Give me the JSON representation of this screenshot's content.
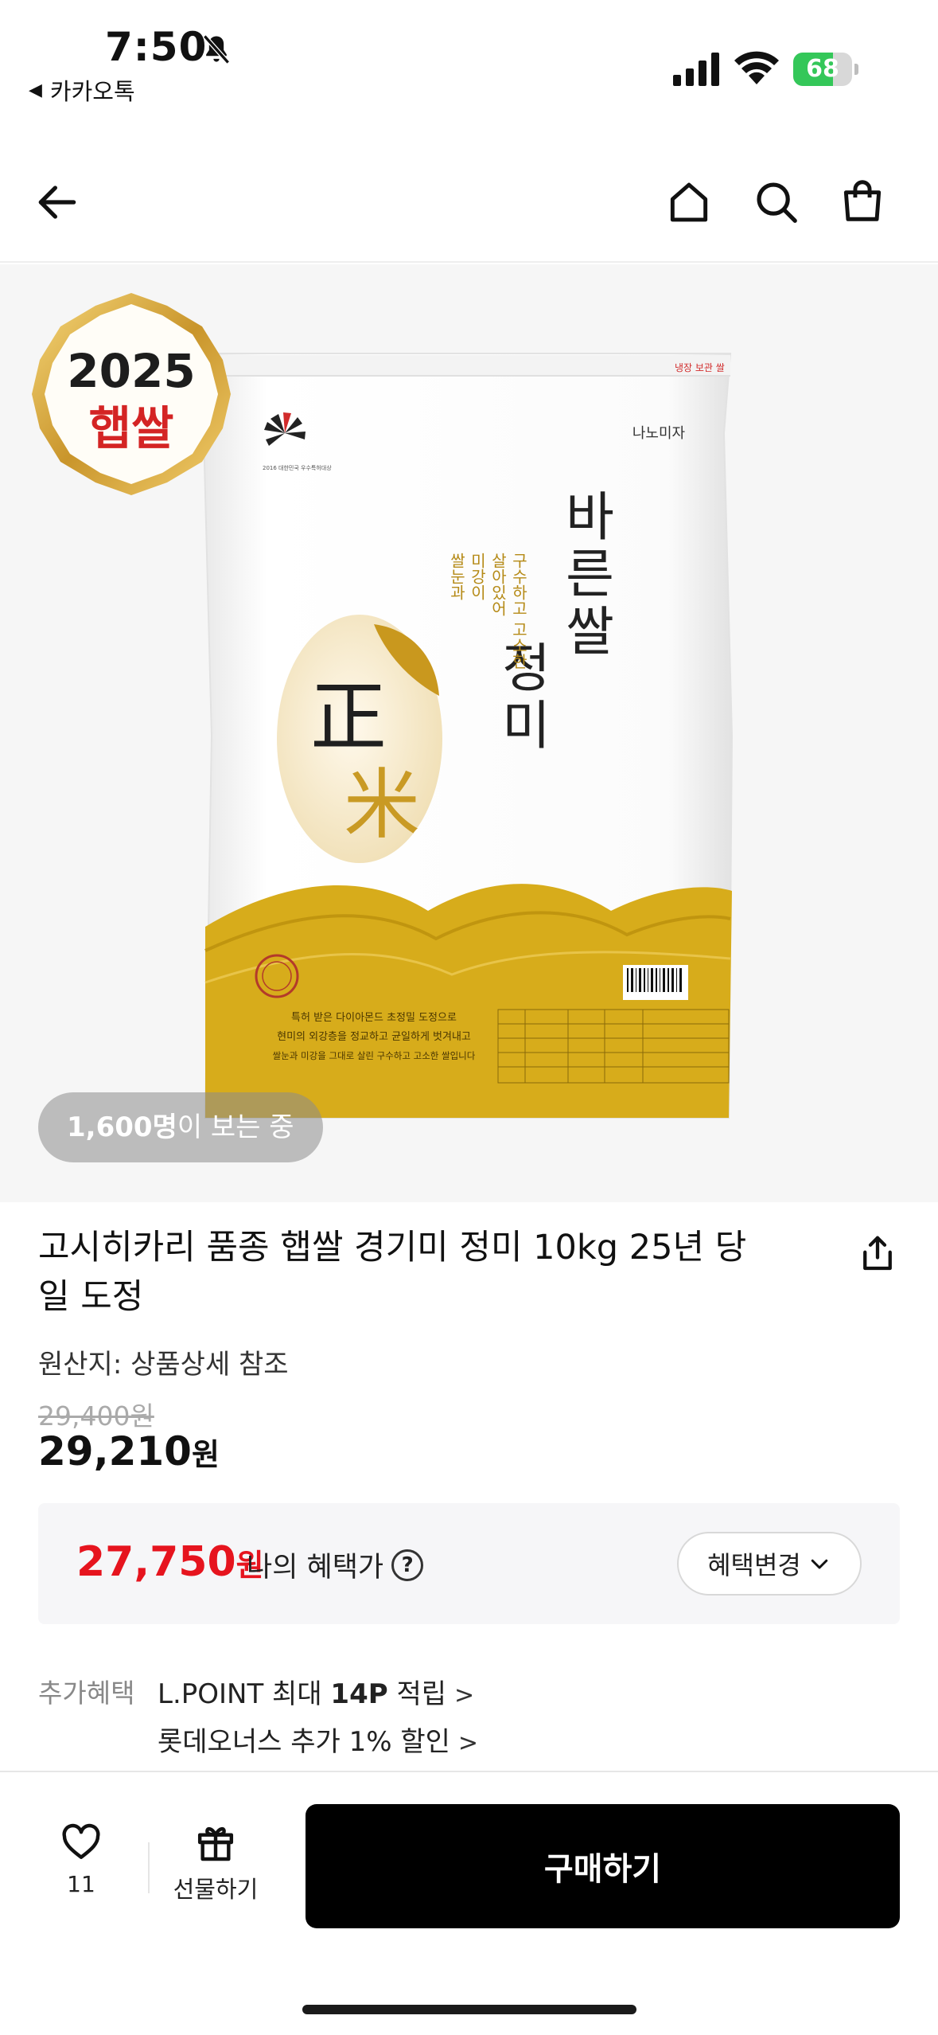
{
  "status_bar": {
    "time": "7:50",
    "back_app": "카카오톡",
    "battery": "68",
    "battery_level": 0.68,
    "icons": [
      "bell-slash-icon",
      "signal-icon",
      "wifi-icon",
      "battery-icon"
    ]
  },
  "header": {
    "icons": [
      "back-arrow-icon",
      "home-icon",
      "search-icon",
      "shopping-bag-icon"
    ]
  },
  "hero": {
    "badge_year": "2025",
    "badge_text": "햅쌀",
    "viewers_count": "1,600명",
    "viewers_suffix": "이 보는 중",
    "package": {
      "brand": "나노미자",
      "top_strip": "냉장 보관 쌀",
      "name_line1": "바른쌀",
      "name_line2": "정미",
      "tagline_col1": "구수하고 고소한",
      "tagline_col2": "살아있어",
      "tagline_col3": "미강이",
      "tagline_col4": "쌀눈과",
      "hanja_top": "正",
      "hanja_bottom": "米",
      "award": "2016 대한민국 우수특허대상",
      "desc_line1": "특허 받은 다이아몬드 초정밀 도정으로",
      "desc_line2": "현미의 외강층을 정교하고 균일하게 벗겨내고",
      "desc_line3": "쌀눈과 미강을 그대로 살린 구수하고 고소한 쌀입니다"
    }
  },
  "product": {
    "title": "고시히카리 품종 햅쌀 경기미 정미 10kg 25년 당일 도정",
    "origin": "원산지: 상품상세 참조",
    "original_price": "29,400원",
    "price_number": "29,210",
    "price_unit": "원"
  },
  "benefit": {
    "price_number": "27,750",
    "price_unit": "원",
    "label": "나의 혜택가",
    "help": "?",
    "change_button": "혜택변경"
  },
  "extra_benefits": {
    "label": "추가혜택",
    "line1_prefix": "L.POINT 최대 ",
    "line1_bold": "14P",
    "line1_suffix": " 적립",
    "line2": "롯데오너스 추가 1% 할인",
    "chevron": ">"
  },
  "bottom_bar": {
    "like_count": "11",
    "gift_label": "선물하기",
    "buy_label": "구매하기"
  },
  "colors": {
    "sale_red": "#e6141e",
    "buy_button": "#000000",
    "battery_green": "#34c759",
    "bag_gold": "#d7ac1b"
  }
}
